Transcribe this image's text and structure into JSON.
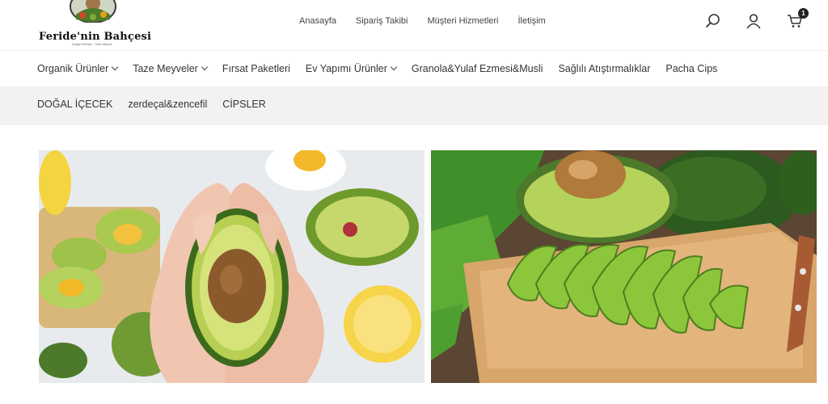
{
  "header": {
    "logo_text": "Feride'nin Bahçesi",
    "logo_tagline": "Doğal Ürünler · Taze Meyve",
    "nav": [
      "Anasayfa",
      "Sipariş Takibi",
      "Müşteri Hizmetleri",
      "İletişim"
    ],
    "cart_count": "1",
    "icons": [
      "search-icon",
      "user-icon",
      "cart-icon"
    ]
  },
  "categories_row1": [
    {
      "label": "Organik Ürünler",
      "dropdown": true
    },
    {
      "label": "Taze Meyveler",
      "dropdown": true
    },
    {
      "label": "Fırsat Paketleri",
      "dropdown": false
    },
    {
      "label": "Ev Yapımı Ürünler",
      "dropdown": true
    },
    {
      "label": "Granola&Yulaf Ezmesi&Musli",
      "dropdown": false
    },
    {
      "label": "Sağlılı Atıştırmalıklar",
      "dropdown": false
    },
    {
      "label": "Pacha Cips",
      "dropdown": false
    }
  ],
  "categories_row2": [
    {
      "label": "DOĞAL İÇECEK"
    },
    {
      "label": "zerdeçal&zencefil"
    },
    {
      "label": "CİPSLER"
    }
  ],
  "banners": [
    {
      "subject": "avocado-half-in-hands"
    },
    {
      "subject": "sliced-avocado-on-cutting-board"
    }
  ]
}
